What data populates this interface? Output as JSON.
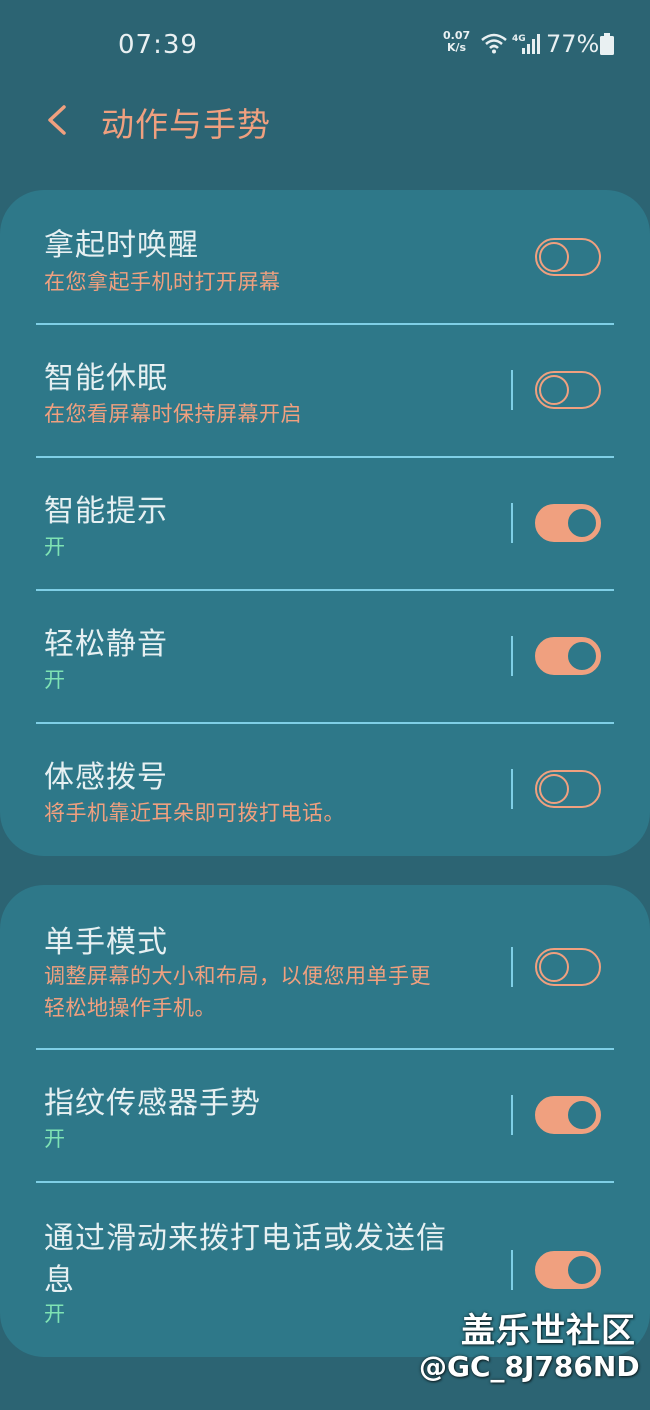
{
  "status_bar": {
    "time": "07:39",
    "net_speed_value": "0.07",
    "net_speed_unit": "K/s",
    "network_type": "4G",
    "battery_percent": "77%"
  },
  "header": {
    "title": "动作与手势"
  },
  "settings_group_1": [
    {
      "title": "拿起时唤醒",
      "subtitle": "在您拿起手机时打开屏幕",
      "enabled": false
    },
    {
      "title": "智能休眠",
      "subtitle": "在您看屏幕时保持屏幕开启",
      "enabled": false
    },
    {
      "title": "智能提示",
      "subtitle": "开",
      "enabled": true
    },
    {
      "title": "轻松静音",
      "subtitle": "开",
      "enabled": true
    },
    {
      "title": "体感拨号",
      "subtitle": "将手机靠近耳朵即可拨打电话。",
      "enabled": false
    }
  ],
  "settings_group_2": [
    {
      "title": "单手模式",
      "subtitle_line1": "调整屏幕的大小和布局，以便您用单手更",
      "subtitle_line2": "轻松地操作手机。",
      "enabled": false
    },
    {
      "title": "指纹传感器手势",
      "subtitle": "开",
      "enabled": true
    },
    {
      "title_line1": "通过滑动来拨打电话或发送信",
      "title_line2": "息",
      "subtitle": "开",
      "enabled": true
    }
  ],
  "watermark": {
    "site": "盖乐世社区",
    "user": "@GC_8J786ND"
  },
  "colors": {
    "background": "#2c6473",
    "card": "#2e7889",
    "accent": "#f0a07f",
    "on_text": "#7fe3b4",
    "divider": "#7fcfe6"
  }
}
